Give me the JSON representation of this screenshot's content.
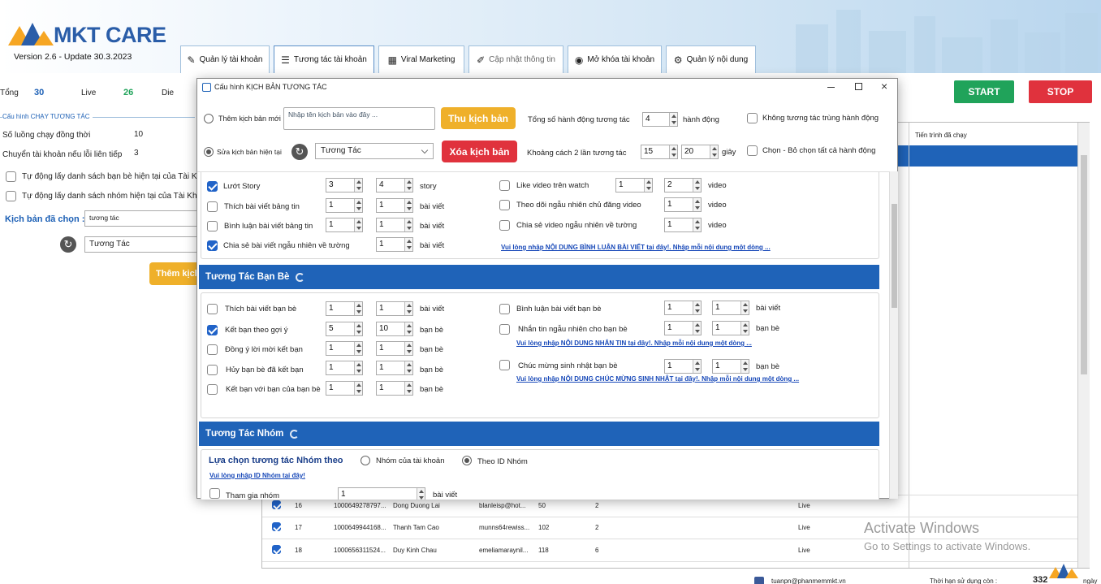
{
  "app": {
    "logo": "MKT CARE",
    "version": "Version 2.6 - Update 30.3.2023"
  },
  "tabs": [
    {
      "label": "Quản lý tài khoản",
      "icon": "wrench-icon"
    },
    {
      "label": "Tương tác tài khoản",
      "icon": "list-icon"
    },
    {
      "label": "Viral Marketing",
      "icon": "grid-icon"
    },
    {
      "label": "Cập nhật thông tin",
      "icon": "pencil-icon"
    },
    {
      "label": "Mở khóa tài khoản",
      "icon": "user-icon"
    },
    {
      "label": "Quản lý nội dung",
      "icon": "gear-icon"
    }
  ],
  "stats": {
    "total_label": "Tổng",
    "total": "30",
    "live_label": "Live",
    "live": "26",
    "die_label": "Die"
  },
  "controls": {
    "start": "START",
    "stop": "STOP"
  },
  "left": {
    "group_title": "Cấu hình CHẠY TƯƠNG TÁC",
    "threads_label": "Số luồng chạy đồng thời",
    "threads": "10",
    "switch_label": "Chuyển tài khoản nếu lỗi liên tiếp",
    "switch": "3",
    "auto_friends": "Tự động lấy danh sách bạn bè hiện tại của Tài Khoản",
    "auto_groups": "Tự động lấy danh sách nhóm hiện tại của Tài Khoản",
    "chosen_label": "Kịch bản đã chọn :",
    "chosen_value": "tương tác",
    "script_select": "Tương Tác",
    "add_button": "Thêm kịch bản"
  },
  "grid": {
    "header_progress": "Tiến trình đã chạy",
    "rows": [
      {
        "no": "16",
        "uid": "1000649278797...",
        "name": "Dong Duong Lai",
        "email": "blanleisp@hot...",
        "friends": "50",
        "col": "2",
        "status": "Live"
      },
      {
        "no": "17",
        "uid": "1000649944168...",
        "name": "Thanh Tam Cao",
        "email": "munns64rewiss...",
        "friends": "102",
        "col": "2",
        "status": "Live"
      },
      {
        "no": "18",
        "uid": "1000656311524...",
        "name": "Duy Kinh Chau",
        "email": "emeliamaraynil...",
        "friends": "118",
        "col": "6",
        "status": "Live"
      }
    ]
  },
  "watermark": {
    "line1": "Activate Windows",
    "line2": "Go to Settings to activate Windows."
  },
  "footer": {
    "email": "tuanpn@phanmemmkt.vn",
    "time_label": "Thời hạn sử dụng còn :",
    "days": "332",
    "days_unit": "ngày"
  },
  "dialog": {
    "title": "Cấu hình KỊCH BẢN TƯƠNG TÁC",
    "add_new_label": "Thêm kịch bản mới",
    "name_placeholder": "Nhập tên kịch bản vào đây ...",
    "save_button": "Thu kịch bản",
    "total_actions_label": "Tổng số hành động tương tác",
    "total_actions": "4",
    "actions_unit": "hành động",
    "no_repeat_label": "Không tương tác trùng hành động",
    "edit_current_label": "Sửa kịch bản hiện tại",
    "current_script": "Tương Tác",
    "delete_button": "Xóa kịch bản",
    "gap_label": "Khoảng cách 2 lần tương tác",
    "gap_min": "15",
    "gap_max": "20",
    "gap_unit": "giây",
    "select_all_label": "Chọn - Bỏ chọn tất cả hành động",
    "profile_actions": [
      {
        "label": "Lướt Story",
        "checked": true,
        "min": "3",
        "max": "4",
        "unit": "story"
      },
      {
        "label": "Thích bài viết bảng tin",
        "checked": false,
        "min": "1",
        "max": "1",
        "unit": "bài viết"
      },
      {
        "label": "Bình luận bài viết bảng tin",
        "checked": false,
        "min": "1",
        "max": "1",
        "unit": "bài viết"
      },
      {
        "label": "Chia sẻ bài viết ngẫu nhiên về tường",
        "checked": true,
        "max": "1",
        "unit": "bài viết"
      }
    ],
    "video_actions": [
      {
        "label": "Like video trên watch",
        "checked": false,
        "min": "1",
        "max": "2",
        "unit": "video"
      },
      {
        "label": "Theo dõi ngẫu nhiên chủ đăng video",
        "checked": false,
        "max": "1",
        "unit": "video"
      },
      {
        "label": "Chia sẻ video ngẫu nhiên về tường",
        "checked": false,
        "max": "1",
        "unit": "video"
      }
    ],
    "comment_link": "Vui lòng nhập NỘI DUNG BÌNH LUẬN BÀI VIẾT tại đây!. Nhập mỗi nội dung một dòng ...",
    "friends_section": "Tương Tác Bạn Bè",
    "friend_actions": [
      {
        "label": "Thích bài viết bạn bè",
        "checked": false,
        "min": "1",
        "max": "1",
        "unit": "bài viết"
      },
      {
        "label": "Kết bạn theo gợi ý",
        "checked": true,
        "min": "5",
        "max": "10",
        "unit": "bạn bè"
      },
      {
        "label": "Đồng ý lời mời kết bạn",
        "checked": false,
        "min": "1",
        "max": "1",
        "unit": "bạn bè"
      },
      {
        "label": "Hủy bạn bè đã kết bạn",
        "checked": false,
        "min": "1",
        "max": "1",
        "unit": "bạn bè"
      },
      {
        "label": "Kết bạn với bạn của bạn bè",
        "checked": false,
        "min": "1",
        "max": "1",
        "unit": "bạn bè"
      }
    ],
    "friend_actions_right": [
      {
        "label": "Bình luận bài viết bạn bè",
        "checked": false,
        "min": "1",
        "max": "1",
        "unit": "bài viết"
      },
      {
        "label": "Nhắn tin ngẫu nhiên cho bạn bè",
        "checked": false,
        "min": "1",
        "max": "1",
        "unit": "bạn bè"
      },
      {
        "label": "Chúc mừng sinh nhật bạn bè",
        "checked": false,
        "min": "1",
        "max": "1",
        "unit": "bạn bè"
      }
    ],
    "message_link": "Vui lòng nhập NỘI DUNG NHẮN TIN tại đây!. Nhập mỗi nội dung một dòng ...",
    "birthday_link": "Vui lòng nhập NỘI DUNG CHÚC MỪNG SINH NHẬT tại đây!. Nhập mỗi nội dung một dòng ...",
    "groups_section": "Tương Tác Nhóm",
    "group_choice_label": "Lựa chọn tương tác Nhóm theo",
    "group_opt1": "Nhóm của tài khoản",
    "group_opt2": "Theo ID Nhóm",
    "group_id_link": "Vui lòng nhập  ID Nhóm tại đây!",
    "join_group_label": "Tham gia nhóm",
    "join_group_value": "1",
    "join_group_unit": "bài viết"
  },
  "colors": {
    "brand": "#2a5da8",
    "section": "#1f63b8",
    "start": "#20a35a",
    "stop": "#e0323d",
    "save": "#efb02a",
    "checked": "#2163c8"
  }
}
